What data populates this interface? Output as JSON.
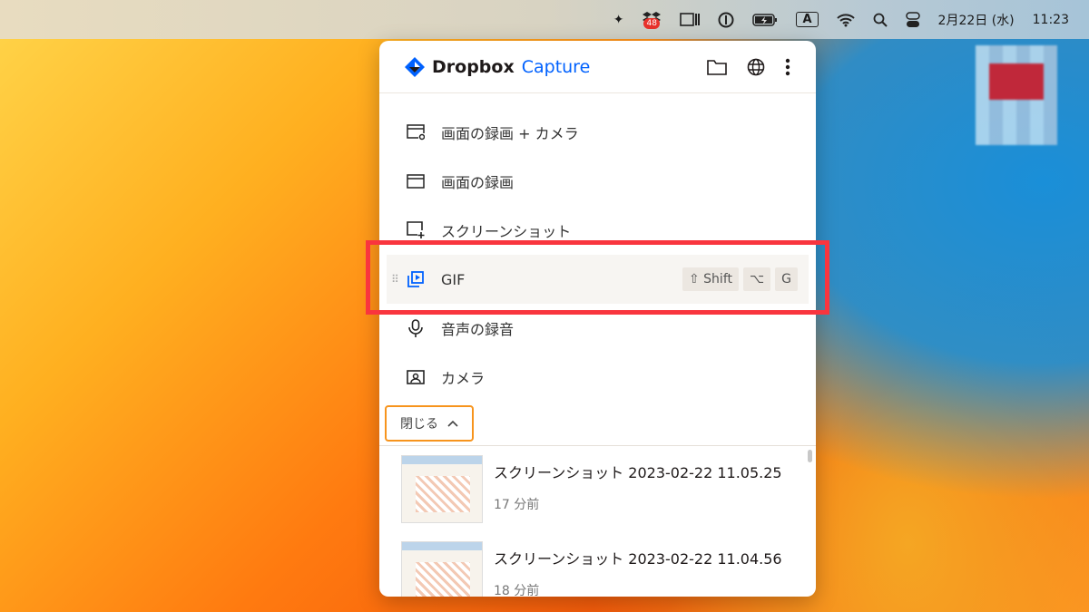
{
  "menubar": {
    "dropbox_badge": "48",
    "input_mode": "A",
    "date": "2月22日 (水)",
    "time": "11:23"
  },
  "panel": {
    "brand": "Dropbox",
    "brand_suffix": "Capture",
    "items": [
      {
        "label": "画面の録画 + カメラ"
      },
      {
        "label": "画面の録画"
      },
      {
        "label": "スクリーンショット"
      },
      {
        "label": "GIF",
        "shortcut": [
          "⇧ Shift",
          "⌥",
          "G"
        ]
      },
      {
        "label": "音声の録音"
      },
      {
        "label": "カメラ"
      }
    ],
    "close_label": "閉じる",
    "recent": [
      {
        "title": "スクリーンショット 2023-02-22 11.05.25",
        "time": "17 分前"
      },
      {
        "title": "スクリーンショット 2023-02-22 11.04.56",
        "time": "18 分前"
      }
    ]
  },
  "colors": {
    "accent": "#0061fe",
    "highlight": "#f9353e",
    "close_border": "#f7941d"
  }
}
